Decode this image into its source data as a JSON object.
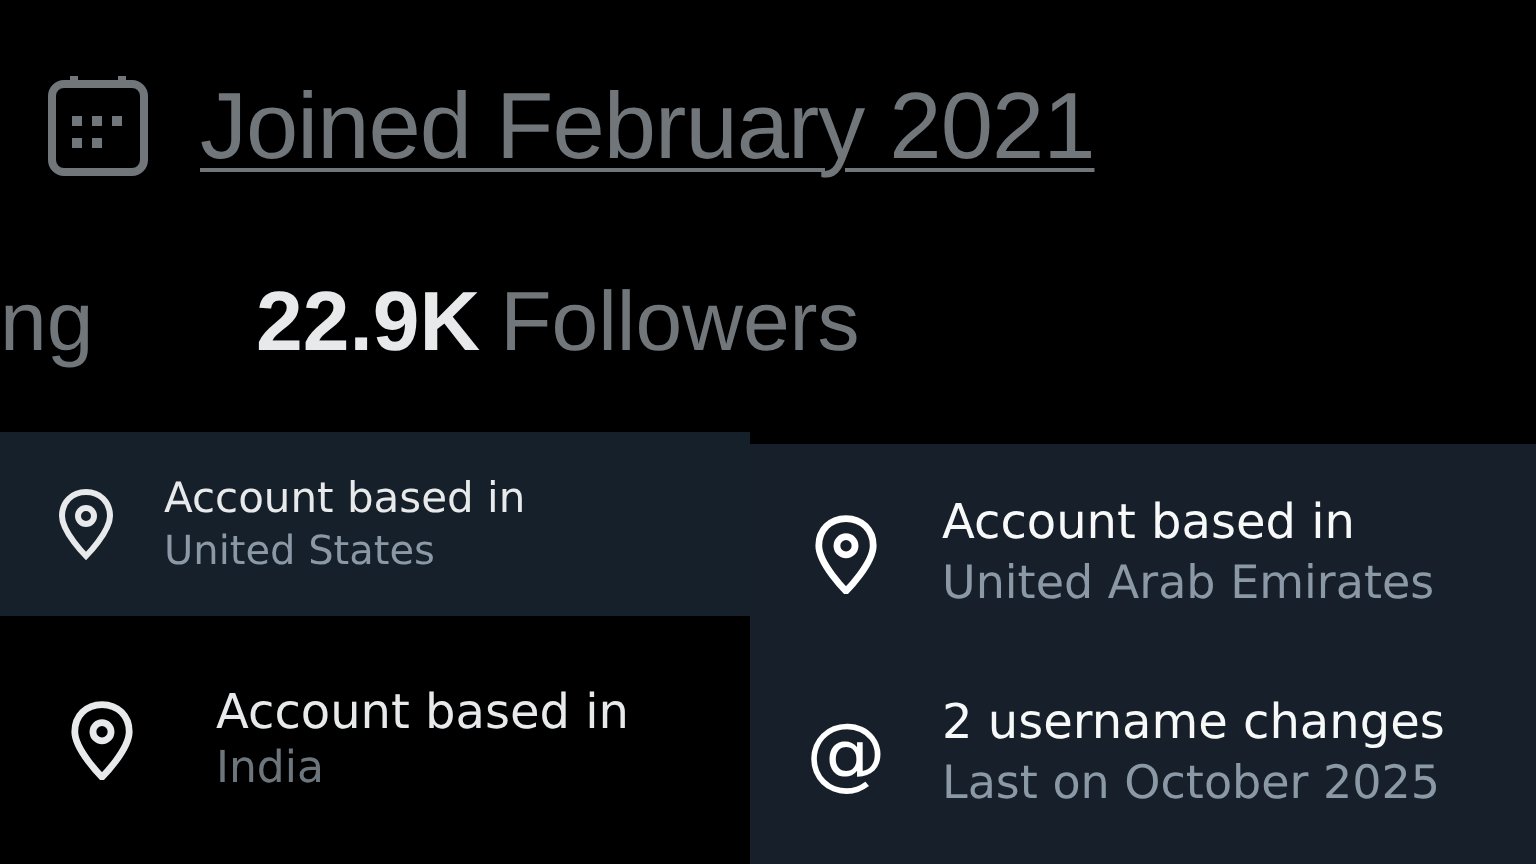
{
  "joined": {
    "text": "Joined February 2021"
  },
  "stats": {
    "following_fragment": "ng",
    "followers_count": "22.9K",
    "followers_label": "Followers"
  },
  "left_panels": [
    {
      "title": "Account based in",
      "subtitle": "United States",
      "kind": "navy"
    },
    {
      "title": "Account based in",
      "subtitle": "India",
      "kind": "black"
    }
  ],
  "right_panel": {
    "items": [
      {
        "kind": "location",
        "title": "Account based in",
        "subtitle": "United Arab Emirates"
      },
      {
        "kind": "at_sign",
        "symbol": "@",
        "title": "2 username changes",
        "subtitle": "Last on October 2025"
      }
    ]
  }
}
